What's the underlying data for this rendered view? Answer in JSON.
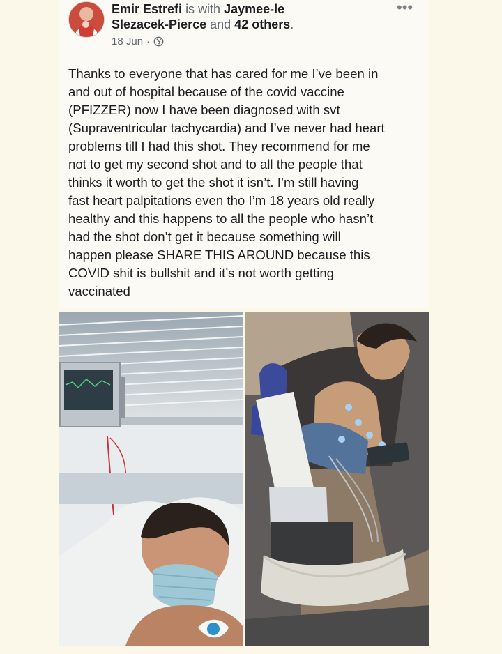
{
  "post": {
    "author": "Emir Estrefi",
    "with_label": "is with",
    "tagged_name_line1": "Jaymee-le",
    "tagged_name_line2": "Slezacek-Pierce",
    "and_label": "and",
    "others_label": "42 others",
    "period": ".",
    "date": "18 Jun",
    "separator": "·",
    "privacy_icon": "globe-icon",
    "more_icon": "more-options-icon",
    "text": "Thanks to everyone that has cared for me I’ve been in\nand out of hospital because of the covid vaccine\n(PFIZZER) now I have been diagnosed with svt\n(Supraventricular tachycardia) and I’ve never had heart\nproblems till I had this shot. They recommend for me\nnot to get my second shot and to all the people that\nthinks it worth to get the shot it isn’t. I’m still having\nfast heart palpitations even tho I’m 18 years old really\nhealthy and this happens to all the people who hasn’t\nhad the shot don’t get it because something will\nhappen please SHARE THIS AROUND because this\nCOVID shit is bullshit and it’s not worth getting\nvaccinated"
  },
  "photos": [
    {
      "name": "hospital-bed-selfie"
    },
    {
      "name": "ecg-monitoring-photo"
    }
  ],
  "colors": {
    "background": "#fbf8e9",
    "card": "#fbfaf4",
    "text": "#1c1e21",
    "secondary_text": "#606770"
  }
}
